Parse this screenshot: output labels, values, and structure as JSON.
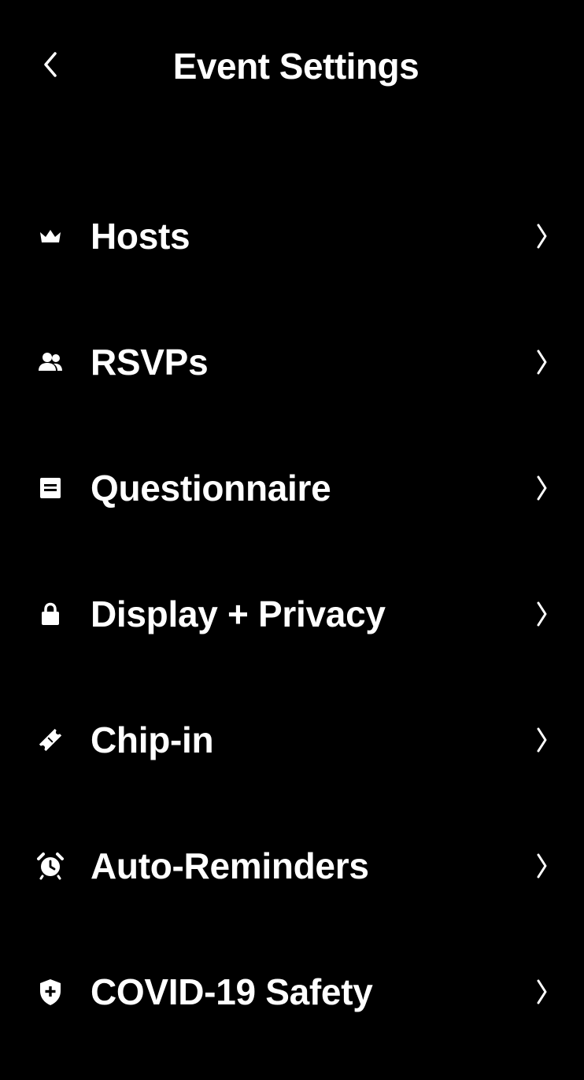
{
  "header": {
    "title": "Event Settings",
    "back_icon": "chevron-left-icon"
  },
  "menu": {
    "items": [
      {
        "label": "Hosts",
        "icon": "crown-icon"
      },
      {
        "label": "RSVPs",
        "icon": "people-icon"
      },
      {
        "label": "Questionnaire",
        "icon": "form-icon"
      },
      {
        "label": "Display + Privacy",
        "icon": "lock-icon"
      },
      {
        "label": "Chip-in",
        "icon": "ticket-icon"
      },
      {
        "label": "Auto-Reminders",
        "icon": "alarm-clock-icon"
      },
      {
        "label": "COVID-19 Safety",
        "icon": "shield-plus-icon"
      }
    ],
    "trailing_icon": "chevron-right-icon"
  },
  "colors": {
    "background": "#000000",
    "text": "#ffffff"
  }
}
